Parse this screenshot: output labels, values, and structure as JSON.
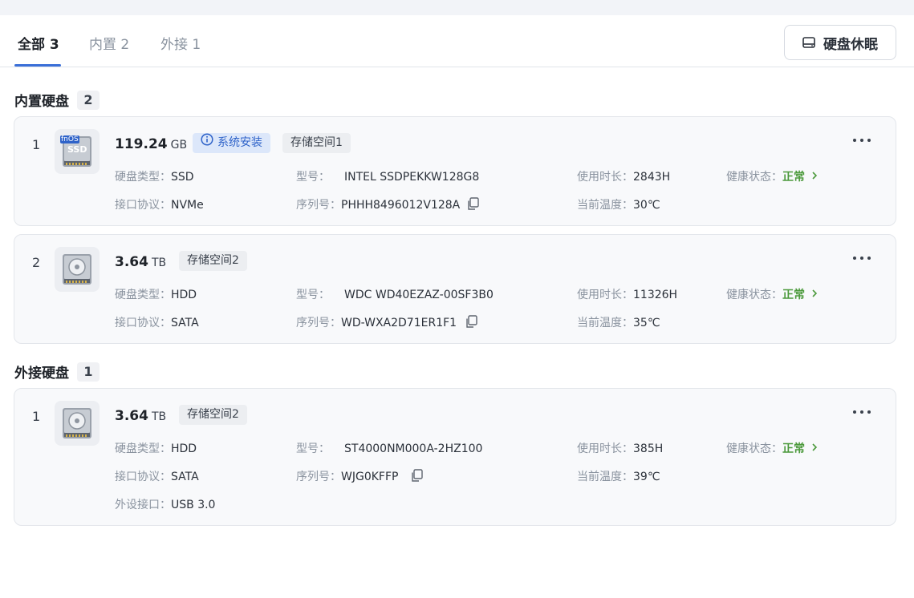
{
  "tabs": [
    {
      "label": "全部",
      "count": "3"
    },
    {
      "label": "内置",
      "count": "2"
    },
    {
      "label": "外接",
      "count": "1"
    }
  ],
  "toolbar": {
    "sleep_label": "硬盘休眠"
  },
  "labels": {
    "type": "硬盘类型：",
    "model": "型号：",
    "usage": "使用时长：",
    "health": "健康状态：",
    "interface": "接口协议：",
    "serial": "序列号：",
    "temp": "当前温度：",
    "ext_port": "外设接口："
  },
  "sections": {
    "internal": {
      "title": "内置硬盘",
      "count": "2"
    },
    "external": {
      "title": "外接硬盘",
      "count": "1"
    }
  },
  "disks": {
    "internal": [
      {
        "index": "1",
        "icon": "ssd-icon",
        "icon_text": "fnOS",
        "icon_sub": "SSD",
        "capacity": "119.24",
        "unit": "GB",
        "system_tag": "系统安装",
        "pool_tag": "存储空间1",
        "type": "SSD",
        "model": "INTEL SSDPEKKW128G8",
        "usage": "2843H",
        "health": "正常",
        "interface": "NVMe",
        "serial": "PHHH8496012V128A",
        "temp": "30℃"
      },
      {
        "index": "2",
        "icon": "hdd-icon",
        "capacity": "3.64",
        "unit": "TB",
        "pool_tag": "存储空间2",
        "type": "HDD",
        "model": "WDC WD40EZAZ-00SF3B0",
        "usage": "11326H",
        "health": "正常",
        "interface": "SATA",
        "serial": "WD-WXA2D71ER1F1",
        "temp": "35℃"
      }
    ],
    "external": [
      {
        "index": "1",
        "icon": "hdd-icon",
        "capacity": "3.64",
        "unit": "TB",
        "pool_tag": "存储空间2",
        "type": "HDD",
        "model": "ST4000NM000A-2HZ100",
        "usage": "385H",
        "health": "正常",
        "interface": "SATA",
        "serial": "WJG0KFFP",
        "temp": "39℃",
        "ext_port": "USB 3.0"
      }
    ]
  },
  "colors": {
    "accent": "#3a6fd8",
    "health_ok": "#4c9a3c",
    "system_tag_bg": "#dce7fa"
  }
}
